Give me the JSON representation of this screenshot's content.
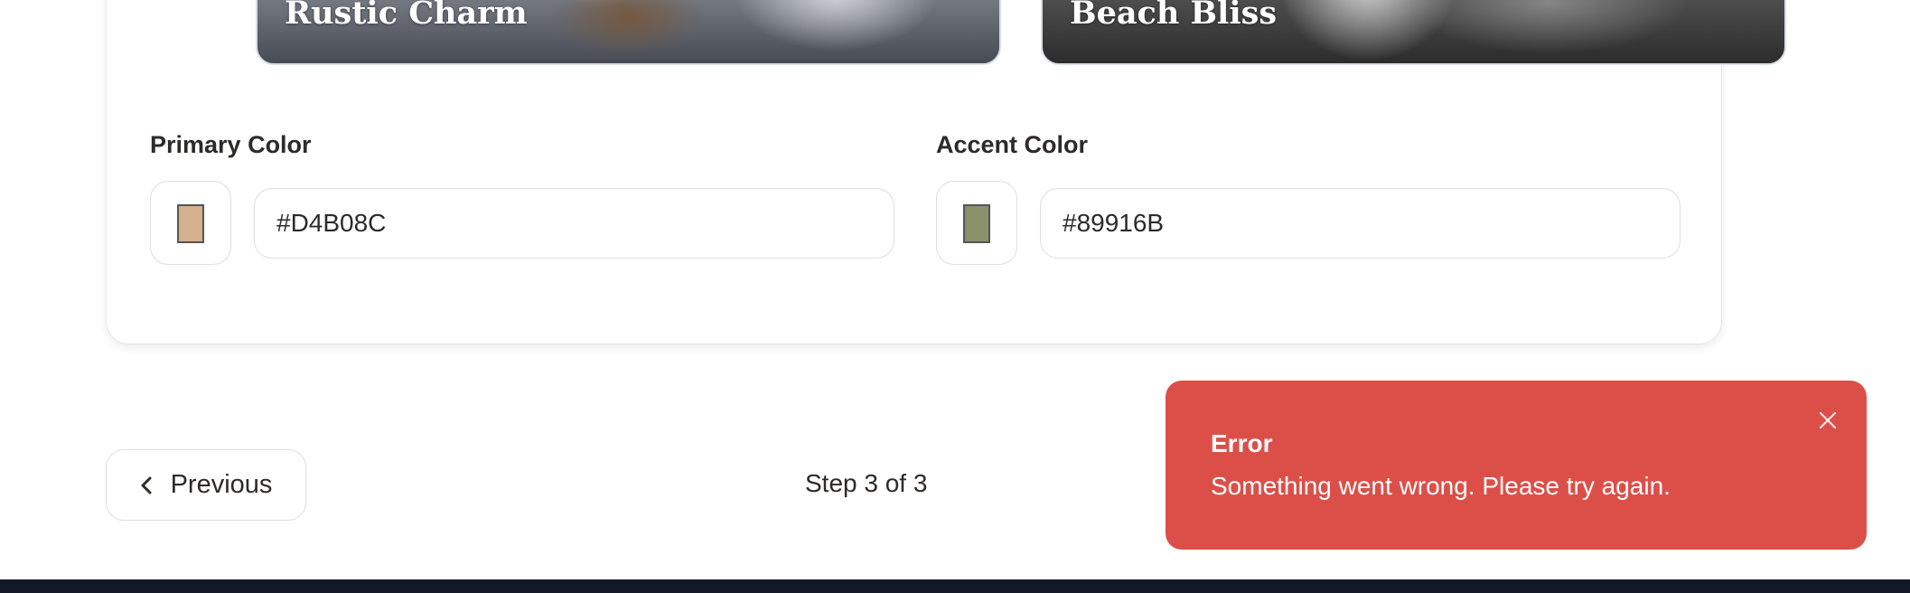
{
  "themes": [
    {
      "title": "Rustic Charm"
    },
    {
      "title": "Beach Bliss"
    }
  ],
  "colors": {
    "primary": {
      "label": "Primary Color",
      "value": "#D4B08C"
    },
    "accent": {
      "label": "Accent Color",
      "value": "#89916B"
    }
  },
  "navigation": {
    "previous_label": "Previous",
    "step_text": "Step 3 of 3"
  },
  "toast": {
    "title": "Error",
    "message": "Something went wrong. Please try again.",
    "background": "#DC4F49"
  },
  "icons": {
    "previous": "chevron-left-icon",
    "close": "close-icon"
  }
}
